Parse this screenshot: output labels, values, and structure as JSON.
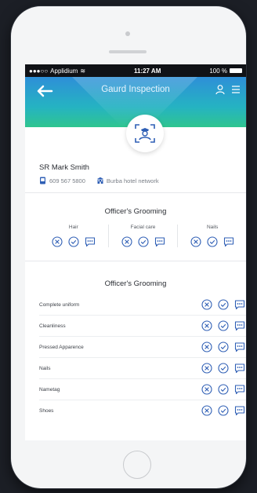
{
  "statusbar": {
    "carrier": "Applidium",
    "time": "11:27 AM",
    "battery": "100 %"
  },
  "header": {
    "title": "Gaurd Inspection"
  },
  "officer": {
    "name": "SR Mark Smith",
    "phone": "609 567 5800",
    "hotel": "Burba hotel network"
  },
  "section1": {
    "title": "Officer's Grooming",
    "groups": [
      {
        "label": "Hair"
      },
      {
        "label": "Facial care"
      },
      {
        "label": "Nails"
      }
    ]
  },
  "section2": {
    "title": "Officer's Grooming",
    "items": [
      {
        "label": "Complete uniform"
      },
      {
        "label": "Cleanliness"
      },
      {
        "label": "Pressed Apparence"
      },
      {
        "label": "Nails"
      },
      {
        "label": "Nametag"
      },
      {
        "label": "Shoes"
      }
    ]
  },
  "colors": {
    "accent": "#2f5fb5",
    "gradient_top": "#2e8fd8",
    "gradient_bottom": "#2fc58f"
  },
  "icons": [
    "back-arrow-icon",
    "user-icon",
    "menu-icon",
    "officer-icon",
    "phone-icon",
    "hotel-icon",
    "reject-icon",
    "approve-icon",
    "comment-icon"
  ]
}
